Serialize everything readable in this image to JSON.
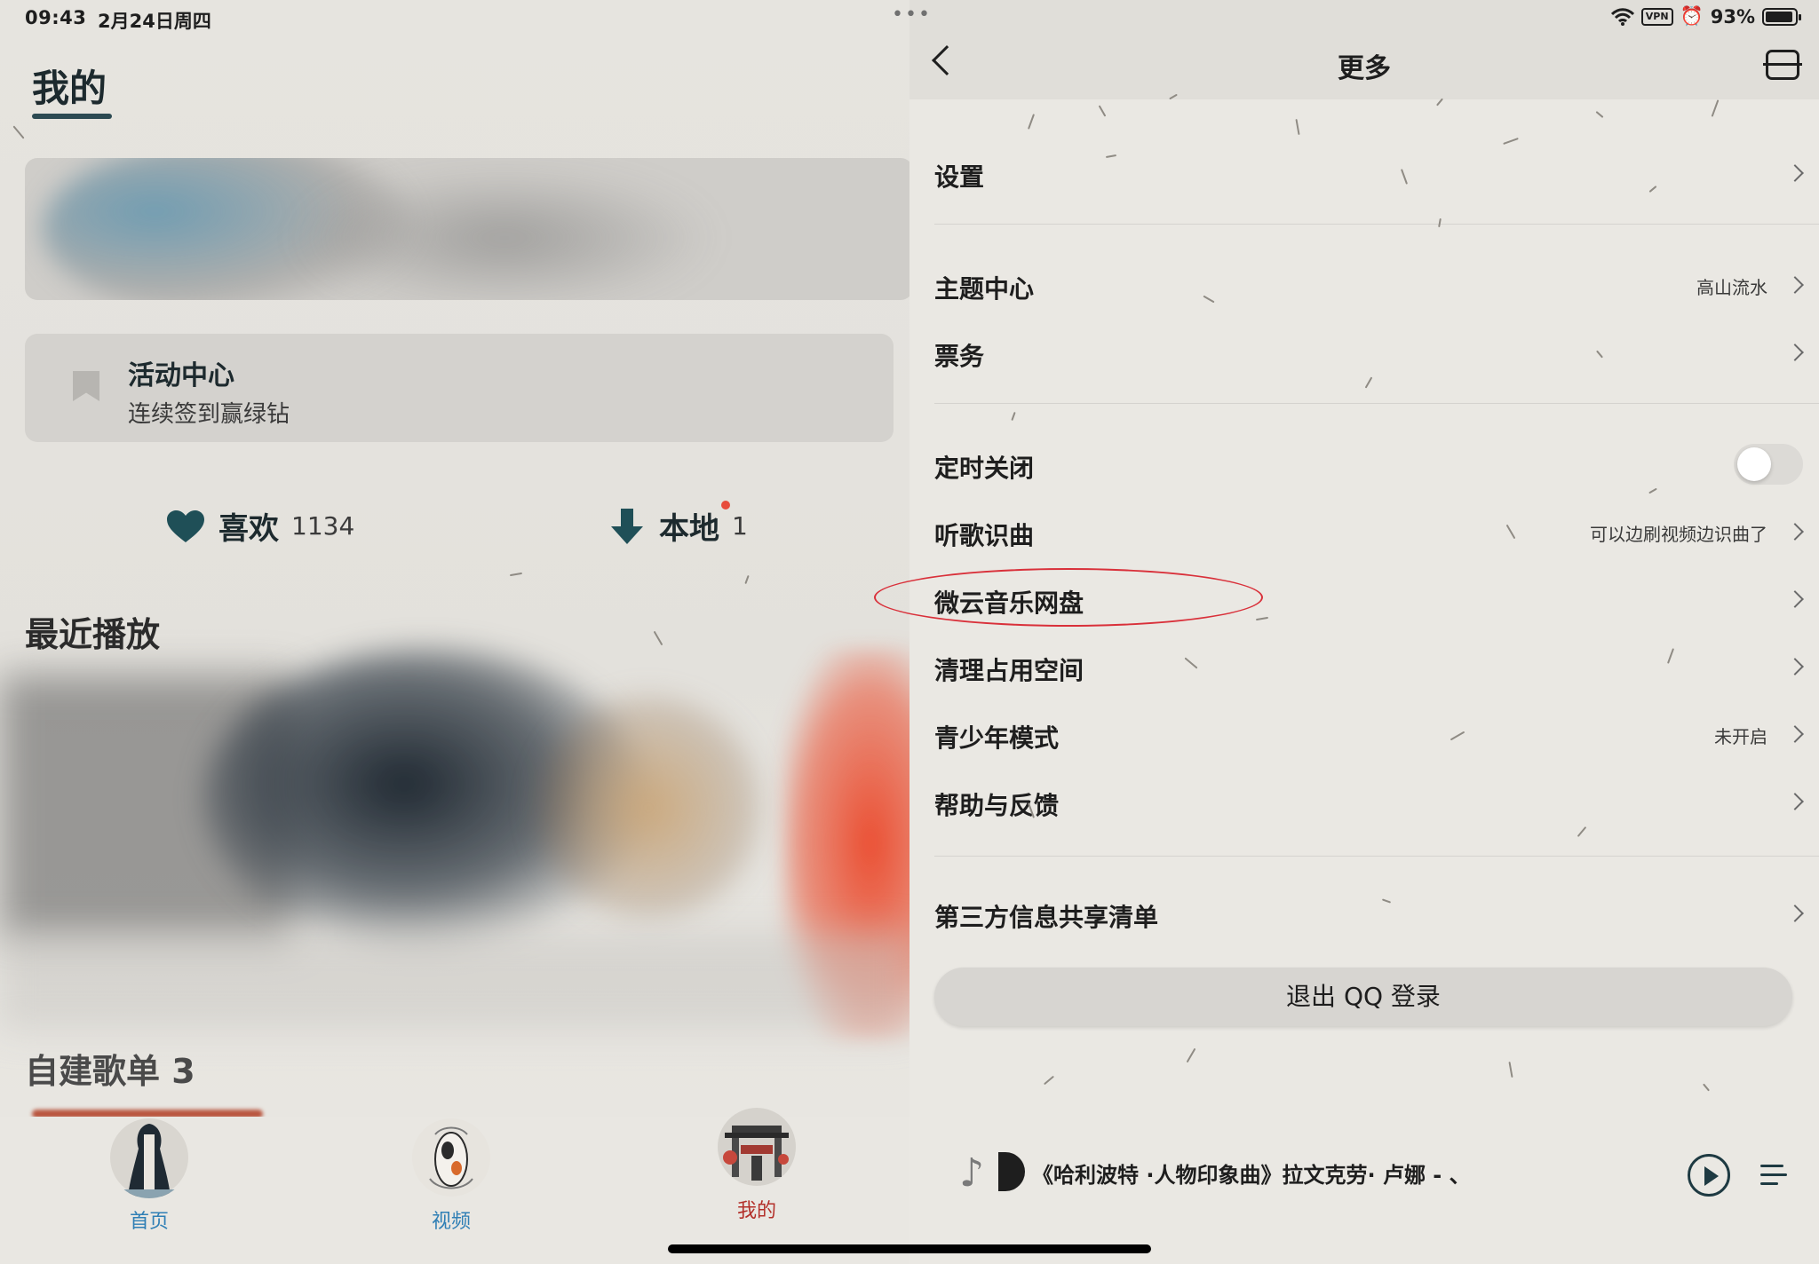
{
  "status_bar": {
    "time": "09:43",
    "date": "2月24日周四",
    "vpn": "VPN",
    "battery_percent": "93%",
    "battery_level": 0.93
  },
  "left": {
    "title": "我的",
    "activity": {
      "title": "活动中心",
      "subtitle": "连续签到赢绿钻"
    },
    "likes": {
      "label": "喜欢",
      "count": "1134"
    },
    "local": {
      "label": "本地",
      "count": "1"
    },
    "recent_title": "最近播放",
    "self_playlist_title": "自建歌单 3"
  },
  "tabs": [
    {
      "label": "首页",
      "color": "#2f7fb5"
    },
    {
      "label": "视频",
      "color": "#2f7fb5"
    },
    {
      "label": "我的",
      "color": "#b3302a"
    }
  ],
  "right": {
    "title": "更多",
    "items": [
      {
        "label": "设置",
        "value": ""
      },
      {
        "label": "主题中心",
        "value": "高山流水"
      },
      {
        "label": "票务",
        "value": ""
      },
      {
        "label": "定时关闭",
        "value": ""
      },
      {
        "label": "听歌识曲",
        "value": "可以边刷视频边识曲了"
      },
      {
        "label": "微云音乐网盘",
        "value": ""
      },
      {
        "label": "清理占用空间",
        "value": ""
      },
      {
        "label": "青少年模式",
        "value": "未开启"
      },
      {
        "label": "帮助与反馈",
        "value": ""
      },
      {
        "label": "第三方信息共享清单",
        "value": ""
      }
    ],
    "timer_enabled": false,
    "logout": "退出 QQ 登录"
  },
  "player": {
    "song": "《哈利波特 ·人物印象曲》拉文克劳· 卢娜 - 、"
  },
  "colors": {
    "accent_ring": "#d9303a",
    "primary_dark": "#1d2a2e"
  }
}
